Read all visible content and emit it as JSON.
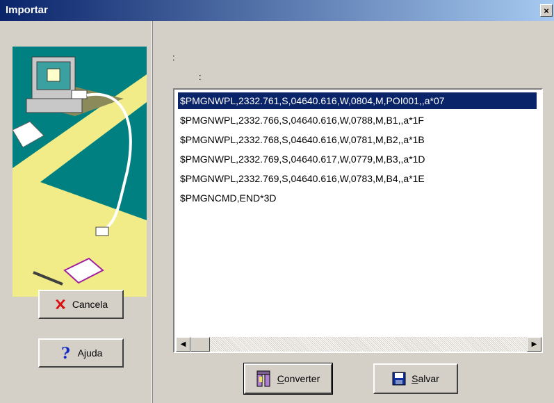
{
  "window": {
    "title": "Importar",
    "close_glyph": "×"
  },
  "info": {
    "line1": ":",
    "line2": ":"
  },
  "list": {
    "items": [
      "$PMGNWPL,2332.761,S,04640.616,W,0804,M,POI001,,a*07",
      "$PMGNWPL,2332.766,S,04640.616,W,0788,M,B1,,a*1F",
      "$PMGNWPL,2332.768,S,04640.616,W,0781,M,B2,,a*1B",
      "$PMGNWPL,2332.769,S,04640.617,W,0779,M,B3,,a*1D",
      "$PMGNWPL,2332.769,S,04640.616,W,0783,M,B4,,a*1E",
      "$PMGNCMD,END*3D"
    ],
    "selected_index": 0
  },
  "buttons": {
    "cancel": "Cancela",
    "help": "Ajuda",
    "convert_underlined": "C",
    "convert_rest": "onverter",
    "save_underlined": "S",
    "save_rest": "alvar"
  },
  "icons": {
    "cancel": "red-x-icon",
    "help": "question-mark-icon",
    "convert": "convert-icon",
    "save": "floppy-disk-icon",
    "illustration": "computer-serial-cable-illustration"
  },
  "colors": {
    "titlebar_start": "#0a246a",
    "titlebar_end": "#a6caf0",
    "selection": "#0a246a",
    "teal": "#008080",
    "yellow": "#f2ec88"
  }
}
